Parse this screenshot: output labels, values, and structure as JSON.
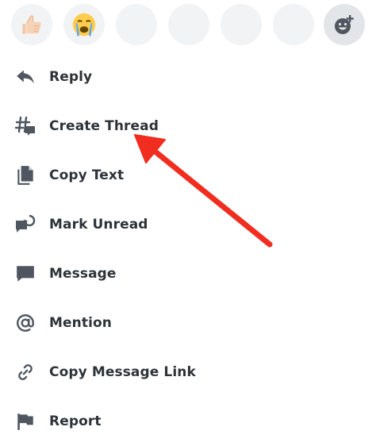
{
  "reactions": [
    {
      "icon": "thumbs-up-emoji",
      "kind": "emoji"
    },
    {
      "icon": "loudly-crying-face-emoji",
      "kind": "emoji"
    },
    {
      "icon": "empty",
      "kind": "placeholder"
    },
    {
      "icon": "empty",
      "kind": "placeholder"
    },
    {
      "icon": "empty",
      "kind": "placeholder"
    },
    {
      "icon": "empty",
      "kind": "placeholder"
    },
    {
      "icon": "add-reaction-icon",
      "kind": "add"
    }
  ],
  "menu": {
    "items": [
      {
        "label": "Reply",
        "icon": "reply-icon"
      },
      {
        "label": "Create Thread",
        "icon": "thread-icon"
      },
      {
        "label": "Copy Text",
        "icon": "copy-icon"
      },
      {
        "label": "Mark Unread",
        "icon": "mark-unread-icon"
      },
      {
        "label": "Message",
        "icon": "message-icon"
      },
      {
        "label": "Mention",
        "icon": "at-icon"
      },
      {
        "label": "Copy Message Link",
        "icon": "link-icon"
      },
      {
        "label": "Report",
        "icon": "flag-icon"
      }
    ]
  },
  "colors": {
    "icon": "#4f5660",
    "text": "#2e3338",
    "reaction_bg": "#f2f3f5",
    "annotation_arrow": "#f02d1f"
  }
}
